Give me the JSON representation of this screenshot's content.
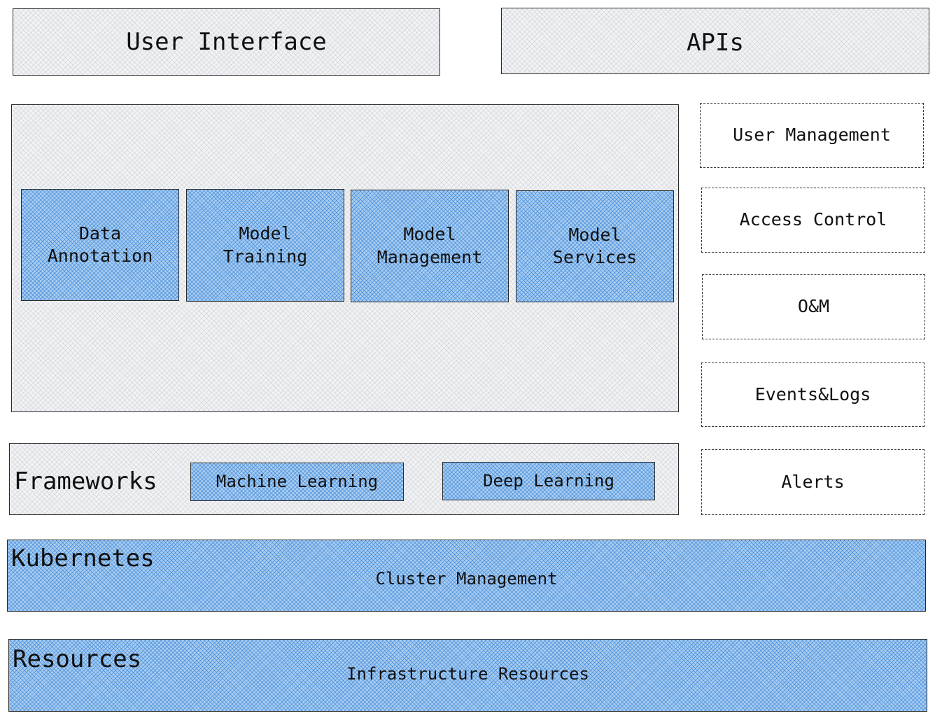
{
  "top": {
    "user_interface": "User Interface",
    "apis": "APIs"
  },
  "platform": {
    "modules": [
      {
        "label": "Data\nAnnotation"
      },
      {
        "label": "Model\nTraining"
      },
      {
        "label": "Model\nManagement"
      },
      {
        "label": "Model\nServices"
      }
    ]
  },
  "side_panel": {
    "items": [
      {
        "label": "User Management"
      },
      {
        "label": "Access Control"
      },
      {
        "label": "O&M"
      },
      {
        "label": "Events&Logs"
      },
      {
        "label": "Alerts"
      }
    ]
  },
  "frameworks": {
    "title": "Frameworks",
    "items": [
      {
        "label": "Machine Learning"
      },
      {
        "label": "Deep Learning"
      }
    ]
  },
  "kubernetes": {
    "title": "Kubernetes",
    "subtitle": "Cluster Management"
  },
  "resources": {
    "title": "Resources",
    "subtitle": "Infrastructure Resources"
  },
  "colors": {
    "accent_blue": "#a9cdf0",
    "hatch_blue": "#2878d2",
    "panel_gray": "#f1f2f4",
    "stroke": "#2a2a2a"
  }
}
